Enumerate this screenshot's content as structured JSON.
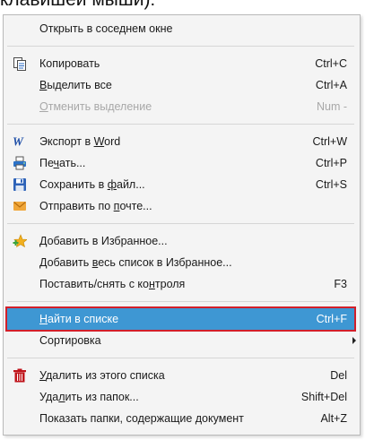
{
  "caption": "клавишей мыши):",
  "menu": {
    "open_adjacent": "Открыть в соседнем окне",
    "copy": {
      "label": "Копировать",
      "shortcut": "Ctrl+C"
    },
    "select_all": {
      "label_u": "В",
      "label_rest": "ыделить все",
      "shortcut": "Ctrl+A"
    },
    "deselect": {
      "label_u": "О",
      "label_rest": "тменить выделение",
      "shortcut": "Num -"
    },
    "export_word": {
      "label_pre": "Экспорт в ",
      "label_u": "W",
      "label_rest": "ord",
      "shortcut": "Ctrl+W"
    },
    "print": {
      "label_pre": "Пе",
      "label_u": "ч",
      "label_rest": "ать...",
      "shortcut": "Ctrl+P"
    },
    "save_file": {
      "label_pre": "Сохранить в ",
      "label_u": "ф",
      "label_rest": "айл...",
      "shortcut": "Ctrl+S"
    },
    "send_mail": {
      "label_pre": "Отправить по ",
      "label_u": "п",
      "label_rest": "очте..."
    },
    "add_fav": {
      "label_u": "Д",
      "label_rest": "обавить в Избранное..."
    },
    "add_all_fav": {
      "label_pre": "Добавить ",
      "label_u": "в",
      "label_rest": "есь список в Избранное..."
    },
    "control": {
      "label_pre": "Поставить/снять с ко",
      "label_u": "н",
      "label_rest": "троля",
      "shortcut": "F3"
    },
    "find": {
      "label_u": "Н",
      "label_rest": "айти в списке",
      "shortcut": "Ctrl+F"
    },
    "sort": {
      "label": "Сортировка"
    },
    "delete_list": {
      "label_u": "У",
      "label_rest": "далить из этого списка",
      "shortcut": "Del"
    },
    "delete_folders": {
      "label_pre": "Уда",
      "label_u": "л",
      "label_rest": "ить из папок...",
      "shortcut": "Shift+Del"
    },
    "show_folders": {
      "label": "Показать папки, содержащие документ",
      "shortcut": "Alt+Z"
    }
  }
}
